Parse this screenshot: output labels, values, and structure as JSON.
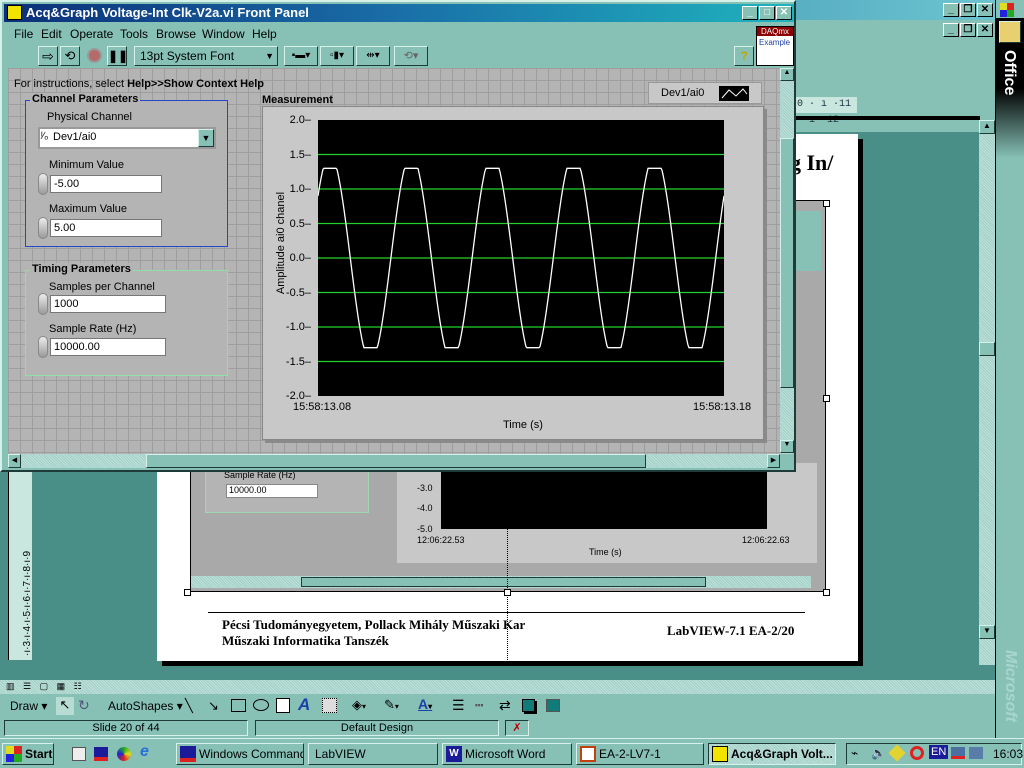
{
  "powerpoint": {
    "ruler_text": "0 · ı ·11 · ı ·12",
    "slide_title_partial": "g In/",
    "footer_left_line1": "Pécsi Tudományegyetem, Pollack Mihály Műszaki Kar",
    "footer_left_line2": "Műszaki Informatika Tanszék",
    "footer_right": "LabVIEW-7.1 EA-2/20",
    "embedded": {
      "sample_rate_label": "Sample Rate (Hz)",
      "sample_rate_value": "10000.00",
      "y_ticks": [
        "-3.0",
        "-4.0",
        "-5.0"
      ],
      "x_start": "12:06:22.53",
      "x_end": "12:06:22.63",
      "x_label": "Time (s)"
    },
    "vruler_ticks": [
      "3",
      "4",
      "5",
      "6",
      "7",
      "8",
      "9"
    ],
    "draw_toolbar": {
      "draw_label": "Draw",
      "autoshapes_label": "AutoShapes"
    },
    "status": {
      "slide": "Slide 20 of 44",
      "design": "Default Design"
    },
    "office_label": "Office",
    "microsoft_label": "Microsoft"
  },
  "labview": {
    "title": "Acq&Graph Voltage-Int Clk-V2a.vi Front Panel",
    "menu": [
      "File",
      "Edit",
      "Operate",
      "Tools",
      "Browse",
      "Window",
      "Help"
    ],
    "font_selector": "13pt System Font",
    "daqmx_badge_top": "DAQmx",
    "daqmx_badge_bottom": "Example",
    "instructions_prefix": "For instructions, select ",
    "instructions_bold": "Help>>Show Context Help",
    "channel": {
      "title": "Channel Parameters",
      "physical_label": "Physical Channel",
      "physical_value": "Dev1/ai0",
      "min_label": "Minimum Value",
      "min_value": "-5.00",
      "max_label": "Maximum Value",
      "max_value": "5.00"
    },
    "timing": {
      "title": "Timing Parameters",
      "spc_label": "Samples per Channel",
      "spc_value": "1000",
      "rate_label": "Sample Rate (Hz)",
      "rate_value": "10000.00"
    },
    "graph": {
      "title": "Measurement",
      "legend": "Dev1/ai0"
    }
  },
  "chart_data": {
    "type": "line",
    "title": "Measurement",
    "xlabel": "Time (s)",
    "ylabel": "Amplitude ai0 chanel",
    "ylim": [
      -2.0,
      2.0
    ],
    "y_ticks": [
      "2.0",
      "1.5",
      "1.0",
      "0.5",
      "0.0",
      "-0.5",
      "-1.0",
      "-1.5",
      "-2.0"
    ],
    "x_tick_labels": [
      "15:58:13.08",
      "15:58:13.18"
    ],
    "grid": true,
    "legend": "top-right",
    "series": [
      {
        "name": "Dev1/ai0",
        "waveform": "clipped sine",
        "cycles": 5,
        "amplitude": 1.3,
        "offset": 0.0,
        "start_phase_value": 0.9
      }
    ]
  },
  "taskbar": {
    "start": "Start",
    "tasks": [
      "Windows Command...",
      "LabVIEW",
      "Microsoft Word",
      "EA-2-LV7-1",
      "Acq&Graph Volt..."
    ],
    "tray_lang": "EN",
    "clock": "16:03"
  }
}
